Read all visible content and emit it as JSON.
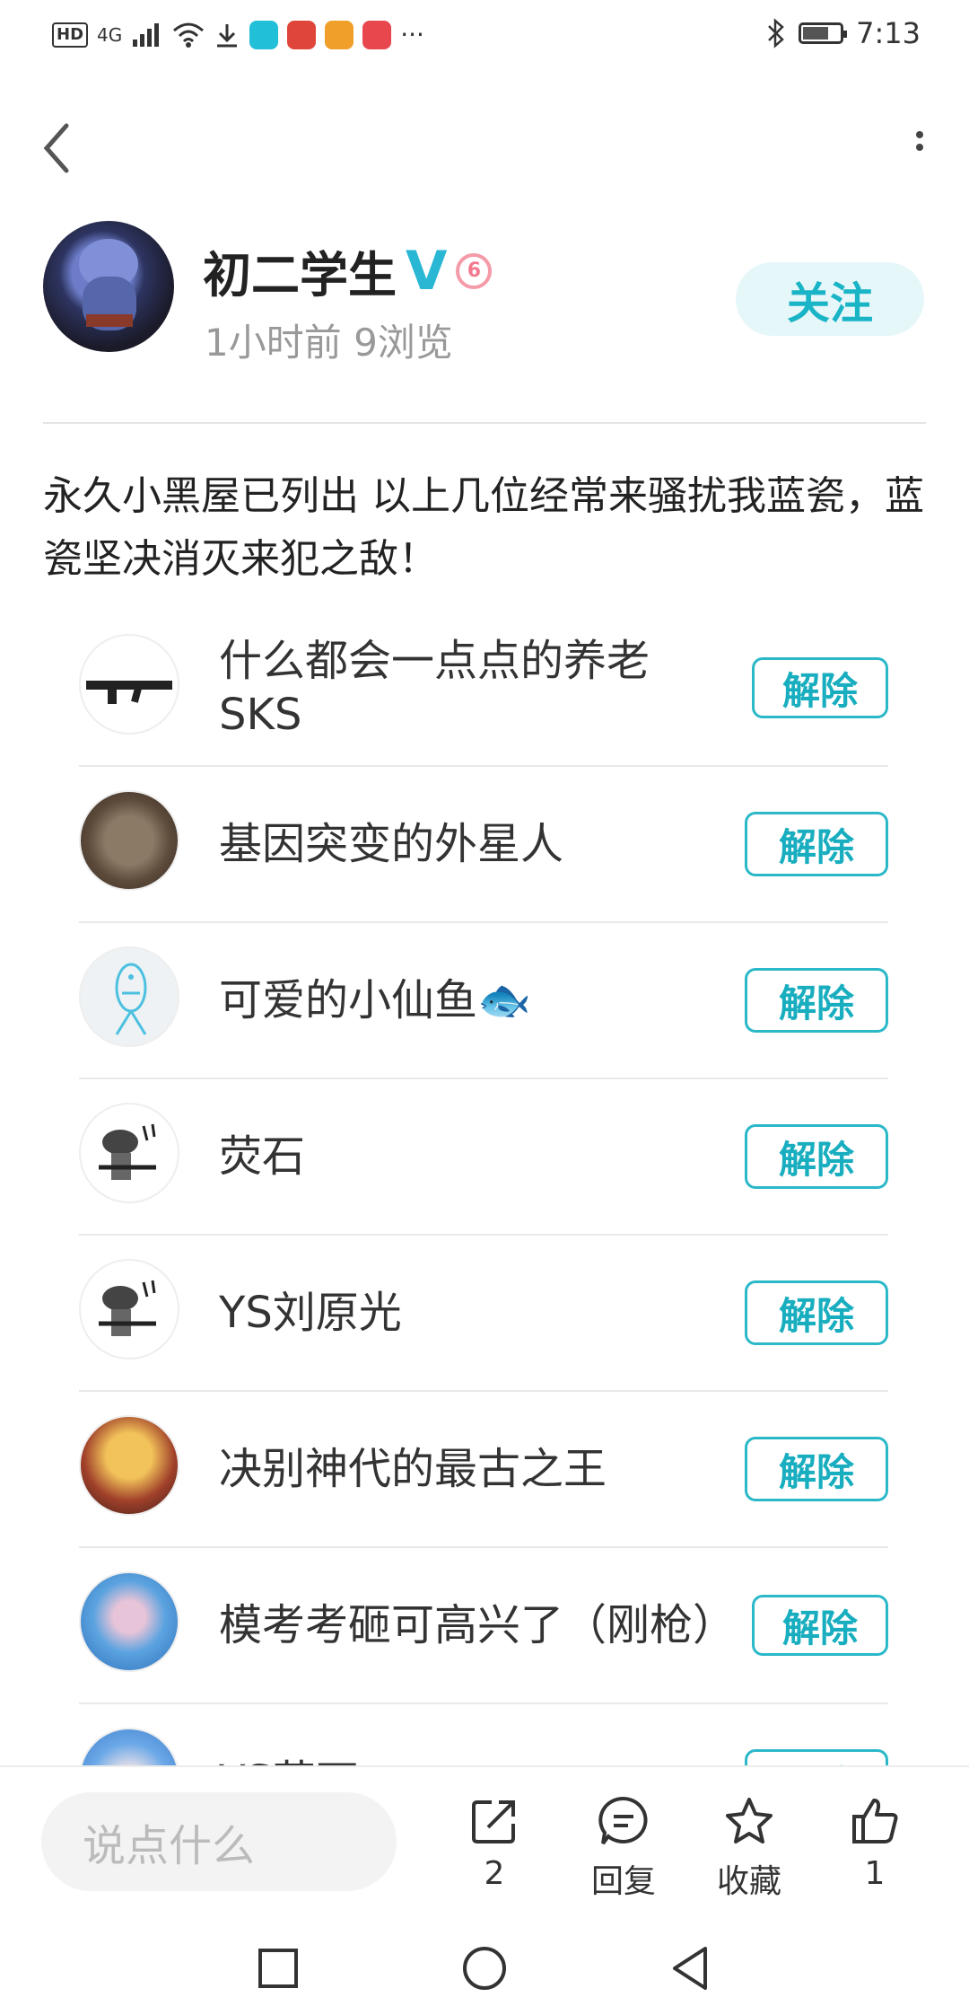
{
  "status_bar": {
    "hd_label": "HD",
    "network_label": "4G",
    "ellipsis": "···",
    "time": "7:13"
  },
  "author": {
    "name": "初二学生",
    "verified_mark": "V",
    "level_mark": "6",
    "meta": "1小时前 9浏览",
    "follow_label": "关注"
  },
  "post": {
    "text": "永久小黑屋已列出 以上几位经常来骚扰我蓝瓷，蓝瓷坚决消灭来犯之敌！"
  },
  "blocked_users": [
    {
      "name": "什么都会一点点的养老SKS",
      "button": "解除"
    },
    {
      "name": "基因突变的外星人",
      "button": "解除"
    },
    {
      "name": "可爱的小仙鱼🐟",
      "button": "解除"
    },
    {
      "name": "荧石",
      "button": "解除"
    },
    {
      "name": "YS刘原光",
      "button": "解除"
    },
    {
      "name": "决别神代的最古之王",
      "button": "解除"
    },
    {
      "name": "模考考砸可高兴了（刚枪）",
      "button": "解除"
    },
    {
      "name": "YS荧石",
      "button": "解除"
    }
  ],
  "bottom_bar": {
    "comment_placeholder": "说点什么",
    "share_count": "2",
    "reply_label": "回复",
    "favorite_label": "收藏",
    "like_count": "1"
  },
  "colors": {
    "accent": "#19b4c6",
    "follow_bg": "#e6f7f9",
    "level_badge": "#f27a8e"
  }
}
